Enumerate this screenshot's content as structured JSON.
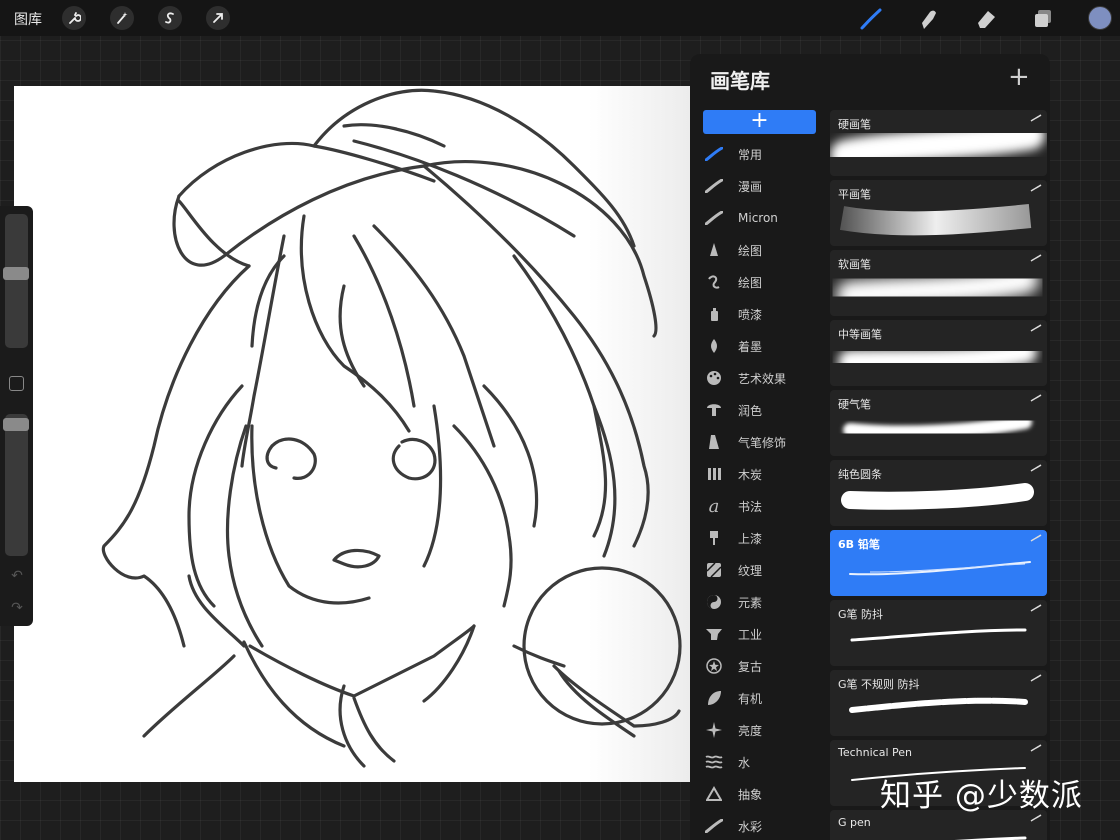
{
  "topbar": {
    "gallery_label": "图库",
    "tools": [
      "wrench-icon",
      "magic-wand-icon",
      "selection-icon",
      "transform-arrow-icon"
    ],
    "right_tools": [
      "brush-icon",
      "smudge-icon",
      "eraser-icon",
      "layers-icon"
    ],
    "accent_color": "#2f7cf6",
    "current_color": "#7e8fc0"
  },
  "library": {
    "title": "画笔库",
    "add_set_symbol": "+",
    "add_brush_symbol": "+",
    "sets": [
      {
        "label": "常用",
        "icon": "brush-stroke-icon",
        "active": true
      },
      {
        "label": "漫画",
        "icon": "brush-stroke-icon"
      },
      {
        "label": "Micron",
        "icon": "brush-stroke-icon"
      },
      {
        "label": "绘图",
        "icon": "pencil-tip-icon"
      },
      {
        "label": "绘图",
        "icon": "squiggle-icon"
      },
      {
        "label": "喷漆",
        "icon": "spray-can-icon"
      },
      {
        "label": "着墨",
        "icon": "ink-nib-icon"
      },
      {
        "label": "艺术效果",
        "icon": "palette-icon"
      },
      {
        "label": "润色",
        "icon": "mushroom-icon"
      },
      {
        "label": "气笔修饰",
        "icon": "airbrush-icon"
      },
      {
        "label": "木炭",
        "icon": "charcoal-icon"
      },
      {
        "label": "书法",
        "icon": "calligraphy-icon"
      },
      {
        "label": "上漆",
        "icon": "paint-brush-icon"
      },
      {
        "label": "纹理",
        "icon": "texture-icon"
      },
      {
        "label": "元素",
        "icon": "yin-yang-icon"
      },
      {
        "label": "工业",
        "icon": "anvil-icon"
      },
      {
        "label": "复古",
        "icon": "star-badge-icon"
      },
      {
        "label": "有机",
        "icon": "leaf-icon"
      },
      {
        "label": "亮度",
        "icon": "sparkle-icon"
      },
      {
        "label": "水",
        "icon": "waves-icon"
      },
      {
        "label": "抽象",
        "icon": "triangle-icon"
      },
      {
        "label": "水彩",
        "icon": "brush-stroke-icon"
      }
    ],
    "brushes": [
      {
        "name": "硬画笔",
        "style": "airy"
      },
      {
        "name": "平画笔",
        "style": "flat"
      },
      {
        "name": "软画笔",
        "style": "soft"
      },
      {
        "name": "中等画笔",
        "style": "medium"
      },
      {
        "name": "硬气笔",
        "style": "hard-air"
      },
      {
        "name": "纯色圆条",
        "style": "solid"
      },
      {
        "name": "6B 铅笔",
        "style": "pencil",
        "selected": true
      },
      {
        "name": "G笔 防抖",
        "style": "gpen"
      },
      {
        "name": "G笔 不规则 防抖",
        "style": "rough"
      },
      {
        "name": "Technical Pen",
        "style": "tech"
      },
      {
        "name": "G pen",
        "style": "gpen2"
      }
    ]
  },
  "watermark": "知乎 @少数派"
}
